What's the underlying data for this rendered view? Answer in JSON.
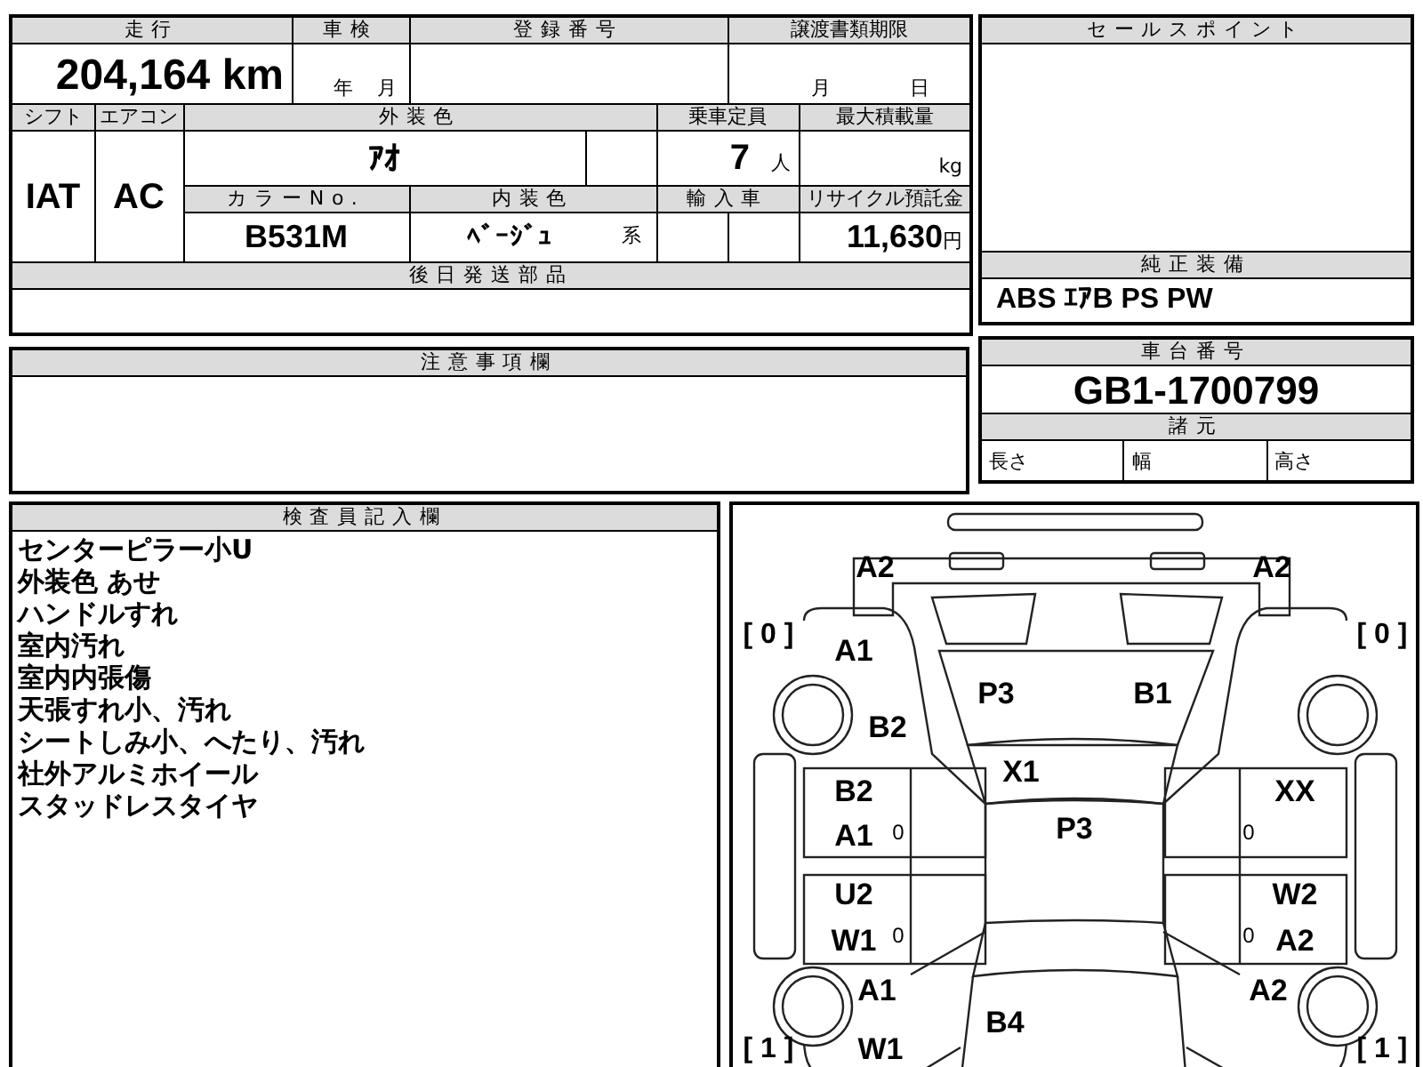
{
  "mileage": {
    "label": "走行",
    "value": "204,164",
    "unit": "km"
  },
  "inspection": {
    "label": "車検",
    "year_unit": "年",
    "month_unit": "月"
  },
  "registration_number": {
    "label": "登録番号"
  },
  "transfer_deadline": {
    "label": "譲渡書類期限",
    "month_unit": "月",
    "day_unit": "日"
  },
  "shift": {
    "label": "シフト",
    "value": "IAT"
  },
  "aircon": {
    "label": "エアコン",
    "value": "AC"
  },
  "exterior_color": {
    "label": "外装色",
    "value": "ｱｵ"
  },
  "capacity": {
    "label": "乗車定員",
    "value": "7",
    "unit": "人"
  },
  "max_load": {
    "label": "最大積載量",
    "unit": "kg"
  },
  "color_no": {
    "label": "カラーNo.",
    "value": "B531M"
  },
  "interior_color": {
    "label": "内装色",
    "value": "ﾍﾞｰｼﾞｭ",
    "suffix": "系"
  },
  "imported": {
    "label": "輸入車"
  },
  "recycle_fee": {
    "label": "リサイクル預託金",
    "value": "11,630",
    "unit": "円"
  },
  "parts_later": {
    "label": "後日発送部品"
  },
  "sale_points": {
    "label": "セールスポイント"
  },
  "equipment": {
    "label": "純正装備",
    "value": "ABS ｴｱB PS PW"
  },
  "notes": {
    "label": "注意事項欄"
  },
  "chassis": {
    "label": "車台番号",
    "value": "GB1-1700799"
  },
  "specs": {
    "label": "諸元",
    "items": [
      "長さ",
      "幅",
      "高さ"
    ]
  },
  "inspector": {
    "label": "検査員記入欄",
    "lines": [
      "センターピラー小U",
      "外装色 あせ",
      "ハンドルすれ",
      "室内汚れ",
      "室内内張傷",
      "天張すれ小、汚れ",
      "シートしみ小、へたり、汚れ",
      "社外アルミホイール",
      "スタッドレスタイヤ"
    ]
  },
  "diagram": {
    "marks": [
      {
        "kind": "code",
        "code": "A2"
      },
      {
        "kind": "code",
        "code": "A2"
      },
      {
        "kind": "tire",
        "code": "[ 0 ]"
      },
      {
        "kind": "code",
        "code": "A1"
      },
      {
        "kind": "tire",
        "code": "[ 0 ]"
      },
      {
        "kind": "code",
        "code": "P3"
      },
      {
        "kind": "code",
        "code": "B1"
      },
      {
        "kind": "code",
        "code": "B2"
      },
      {
        "kind": "code",
        "code": "X1"
      },
      {
        "kind": "code",
        "code": "B2"
      },
      {
        "kind": "code",
        "code": "XX"
      },
      {
        "kind": "code",
        "code": "A1"
      },
      {
        "kind": "small",
        "code": "0"
      },
      {
        "kind": "code",
        "code": "P3"
      },
      {
        "kind": "small",
        "code": "0"
      },
      {
        "kind": "code",
        "code": "U2"
      },
      {
        "kind": "code",
        "code": "W2"
      },
      {
        "kind": "code",
        "code": "W1"
      },
      {
        "kind": "small",
        "code": "0"
      },
      {
        "kind": "small",
        "code": "0"
      },
      {
        "kind": "code",
        "code": "A2"
      },
      {
        "kind": "code",
        "code": "A1"
      },
      {
        "kind": "code",
        "code": "A2"
      },
      {
        "kind": "code",
        "code": "B4"
      },
      {
        "kind": "tire",
        "code": "[ 1 ]"
      },
      {
        "kind": "code",
        "code": "W1"
      },
      {
        "kind": "tire",
        "code": "[ 1 ]"
      }
    ]
  }
}
